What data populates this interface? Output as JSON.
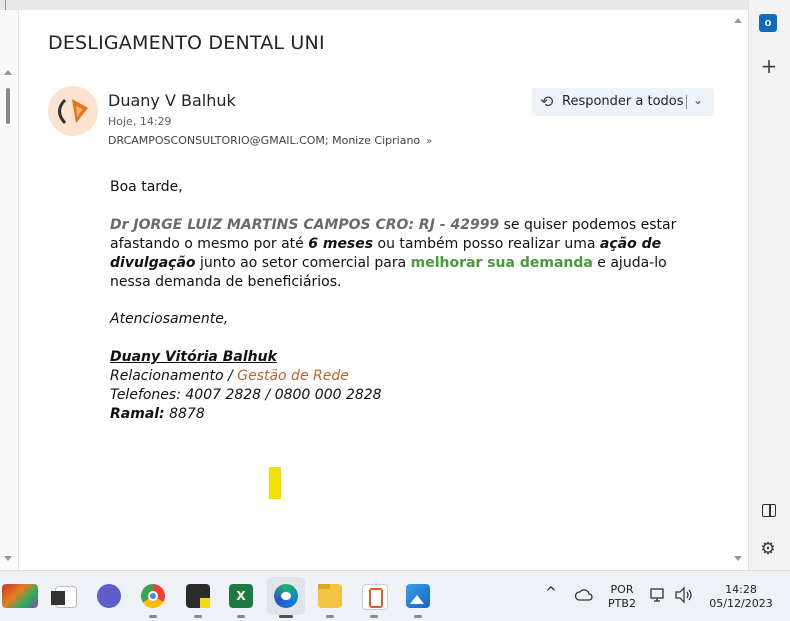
{
  "email": {
    "subject": "DESLIGAMENTO DENTAL UNI",
    "sender": "Duany V Balhuk",
    "date": "Hoje, 14:29",
    "recipients": "DRCAMPOSCONSULTORIO@GMAIL.COM; Monize Cipriano",
    "reply_label": "Responder a todos"
  },
  "body": {
    "greeting": "Boa tarde,",
    "p1_bold": "Dr JORGE LUIZ MARTINS CAMPOS CRO: RJ - 42999",
    "p1_t1": " se quiser podemos estar afastando o mesmo por até ",
    "p1_b2": "6 meses",
    "p1_t2": " ou também posso realizar uma ",
    "p1_b3": "ação de divulgação",
    "p1_t3": " junto ao setor comercial para ",
    "p1_green": "melhorar sua demanda",
    "p1_t4": " e ajuda-lo nessa demanda de beneficiários.",
    "closing": "Atenciosamente,",
    "sig_name": "Duany Vitória Balhuk ",
    "sig_role": "Relacionamento / ",
    "sig_dept": "Gestão de Rede",
    "sig_phones": "Telefones: 4007 2828 / 0800 000 2828",
    "sig_ramal_label": "Ramal:",
    "sig_ramal_value": " 8878"
  },
  "sidebar": {
    "outlook_letter": "o",
    "plus": "+",
    "gear": "⚙"
  },
  "taskbar": {
    "lang_top": "POR",
    "lang_bottom": "PTB2",
    "time": "14:28",
    "date": "05/12/2023",
    "chevron": "^"
  },
  "colors": {
    "accent": "#0f6cbd",
    "green_text": "#4a9a3d",
    "orange_text": "#c0662a",
    "marker": "#f2e100"
  }
}
